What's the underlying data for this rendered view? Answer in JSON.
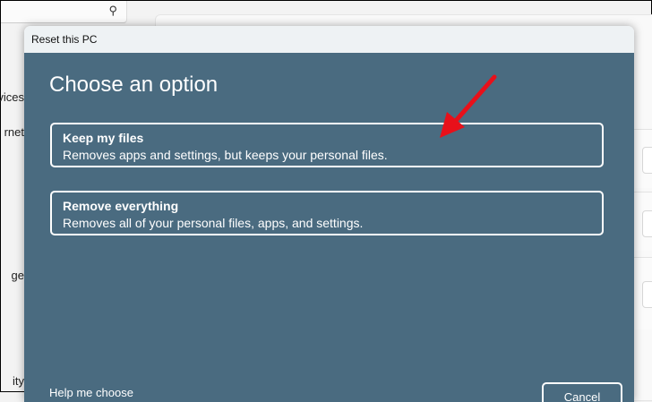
{
  "background": {
    "search_icon": "search-icon",
    "nav_fragments": [
      "vices",
      "rnet",
      "ge",
      "ity"
    ]
  },
  "dialog": {
    "title": "Reset this PC",
    "heading": "Choose an option",
    "options": [
      {
        "title": "Keep my files",
        "description": "Removes apps and settings, but keeps your personal files."
      },
      {
        "title": "Remove everything",
        "description": "Removes all of your personal files, apps, and settings."
      }
    ],
    "help_link": "Help me choose",
    "cancel_label": "Cancel"
  },
  "annotation": {
    "arrow_color": "#e8101a"
  }
}
